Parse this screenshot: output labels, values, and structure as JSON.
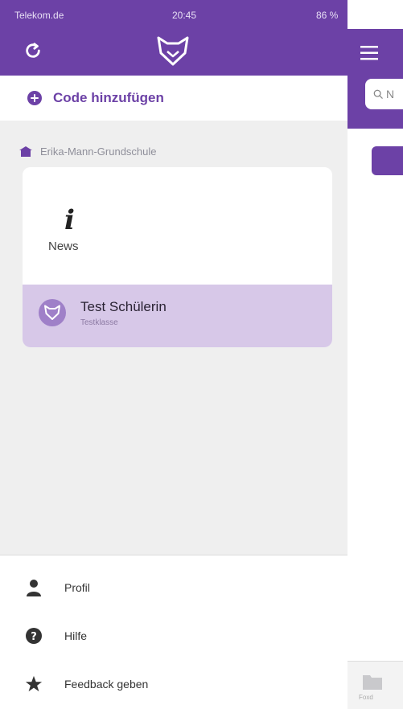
{
  "status_bar": {
    "carrier": "Telekom.de",
    "time": "20:45",
    "battery": "86 %"
  },
  "drawer": {
    "add_code_label": "Code hinzufügen",
    "school_name": "Erika-Mann-Grundschule",
    "news_label": "News",
    "student_name": "Test Schülerin",
    "student_class": "Testklasse",
    "menu": {
      "profile": "Profil",
      "help": "Hilfe",
      "feedback": "Feedback geben"
    }
  },
  "main": {
    "search_placeholder": "N",
    "tab_label": "Foxd"
  },
  "colors": {
    "brand": "#6c41a6",
    "selected_row": "#d7c8e8"
  }
}
